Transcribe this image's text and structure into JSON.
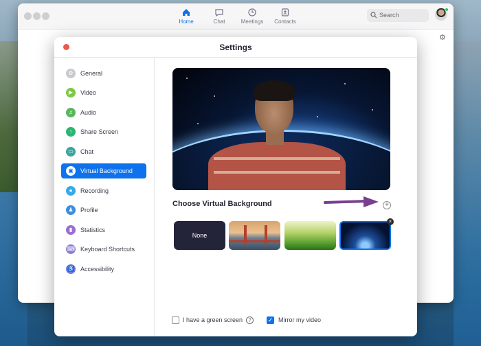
{
  "zoom": {
    "nav": [
      {
        "label": "Home",
        "icon": "home-icon",
        "active": true
      },
      {
        "label": "Chat",
        "icon": "chat-icon",
        "active": false
      },
      {
        "label": "Meetings",
        "icon": "clock-icon",
        "active": false
      },
      {
        "label": "Contacts",
        "icon": "contacts-icon",
        "active": false
      }
    ],
    "search_placeholder": "Search"
  },
  "settings": {
    "title": "Settings",
    "sidebar": [
      {
        "label": "General",
        "icon": "gear-icon",
        "color": "#c9c9cf",
        "active": false
      },
      {
        "label": "Video",
        "icon": "video-icon",
        "color": "#7ac943",
        "active": false
      },
      {
        "label": "Audio",
        "icon": "headphones-icon",
        "color": "#5ab55e",
        "active": false
      },
      {
        "label": "Share Screen",
        "icon": "share-screen-icon",
        "color": "#2bb673",
        "active": false
      },
      {
        "label": "Chat",
        "icon": "chat-icon",
        "color": "#3aa79d",
        "active": false
      },
      {
        "label": "Virtual Background",
        "icon": "portrait-icon",
        "color": "#ffffff",
        "active": true
      },
      {
        "label": "Recording",
        "icon": "record-icon",
        "color": "#38a9e8",
        "active": false
      },
      {
        "label": "Profile",
        "icon": "person-icon",
        "color": "#3b8de0",
        "active": false
      },
      {
        "label": "Statistics",
        "icon": "bar-chart-icon",
        "color": "#9b6fd1",
        "active": false
      },
      {
        "label": "Keyboard Shortcuts",
        "icon": "keyboard-icon",
        "color": "#8f7fd6",
        "active": false
      },
      {
        "label": "Accessibility",
        "icon": "accessibility-icon",
        "color": "#6f7cd9",
        "active": false
      }
    ],
    "choose_title": "Choose Virtual Background",
    "backgrounds": [
      {
        "label": "None"
      },
      {
        "label": ""
      },
      {
        "label": ""
      },
      {
        "label": ""
      }
    ],
    "green_screen_label": "I have a green screen",
    "green_screen_checked": false,
    "mirror_label": "Mirror my video",
    "mirror_checked": true
  },
  "colors": {
    "accent": "#0e72ed",
    "close": "#e85a50",
    "annotation_arrow": "#7a3e8f"
  }
}
